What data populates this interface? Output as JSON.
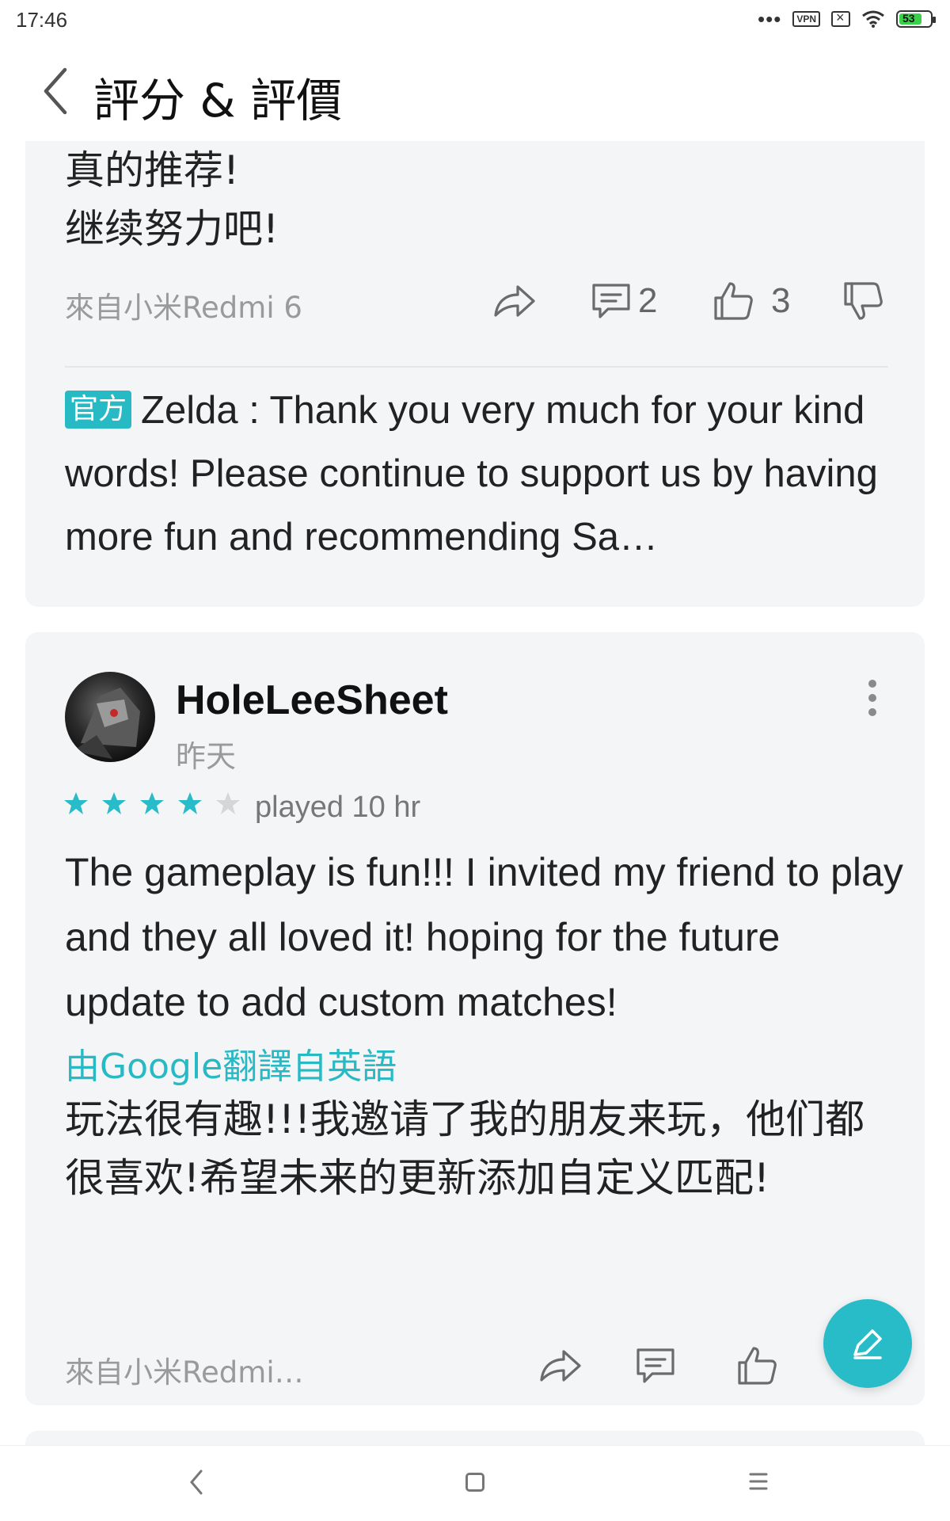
{
  "status_bar": {
    "time": "17:46",
    "icons": [
      "dots-icon",
      "vpn-icon",
      "sim-icon",
      "wifi-icon",
      "battery-icon"
    ],
    "vpn_label": "VPN",
    "battery_level": "53",
    "battery_color": "#39d04a"
  },
  "header": {
    "title": "評分 & 評價",
    "back_icon": "chevron-left-icon"
  },
  "reviews": [
    {
      "text_lines": [
        "真的推荐!",
        "继续努力吧!"
      ],
      "device": "來自小米Redmi 6",
      "comment_count": "2",
      "like_count": "3",
      "official_reply": {
        "badge": "官方",
        "text": "Zelda : Thank you very much for your kind words! Please continue to support us by having more fun and recommending Sa…"
      }
    },
    {
      "username": "HoleLeeSheet",
      "date": "昨天",
      "rating": 4,
      "max_rating": 5,
      "played": "played 10 hr",
      "text_en": "The gameplay is fun!!! I invited my friend to play and they all loved it! hoping for the future update to add custom matches!",
      "translated_label": "由Google翻譯自英語",
      "text_zh": "玩法很有趣!!!我邀请了我的朋友来玩，他们都很喜欢!希望未来的更新添加自定义匹配!",
      "device": "來自小米Redmi…"
    }
  ],
  "colors": {
    "accent": "#28bcc8",
    "star_filled": "#28bcc8",
    "star_empty": "#d6d6d6",
    "card_bg": "#f4f5f7"
  },
  "fab_icon": "edit-pen-icon",
  "nav": [
    "nav-back-icon",
    "nav-home-icon",
    "nav-menu-icon"
  ]
}
